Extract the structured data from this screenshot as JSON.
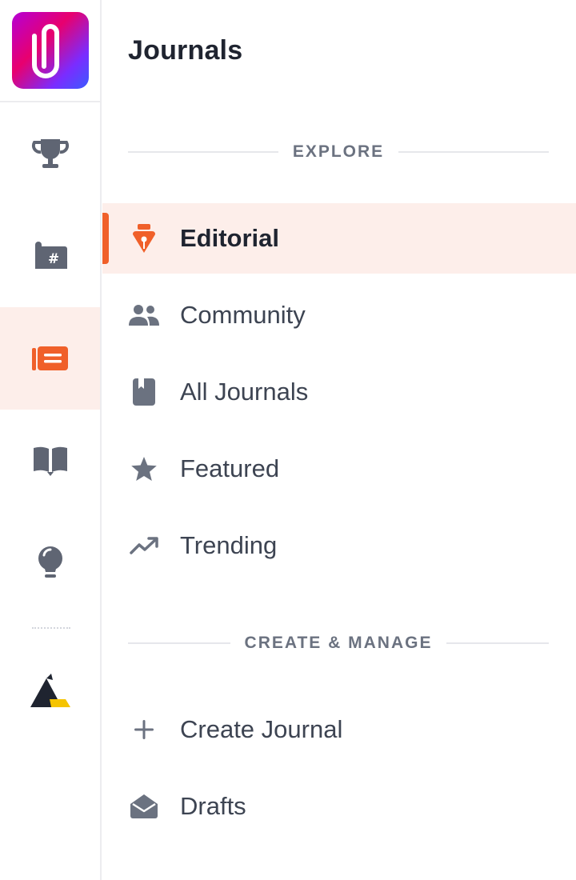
{
  "app": {
    "title": "Journals"
  },
  "rail": {
    "items": [
      {
        "name": "trophy-icon",
        "active": false
      },
      {
        "name": "hashtag-board-icon",
        "active": false
      },
      {
        "name": "newspaper-icon",
        "active": true
      },
      {
        "name": "open-book-icon",
        "active": false
      },
      {
        "name": "lightbulb-icon",
        "active": false
      },
      {
        "name": "brand-triangle-icon",
        "active": false
      }
    ]
  },
  "explore": {
    "heading": "EXPLORE",
    "items": [
      {
        "label": "Editorial",
        "icon": "pen-nib-icon",
        "active": true
      },
      {
        "label": "Community",
        "icon": "people-icon",
        "active": false
      },
      {
        "label": "All Journals",
        "icon": "book-icon",
        "active": false
      },
      {
        "label": "Featured",
        "icon": "star-icon",
        "active": false
      },
      {
        "label": "Trending",
        "icon": "trending-icon",
        "active": false
      }
    ]
  },
  "manage": {
    "heading": "CREATE & MANAGE",
    "items": [
      {
        "label": "Create Journal",
        "icon": "plus-icon"
      },
      {
        "label": "Drafts",
        "icon": "envelope-open-icon"
      }
    ]
  },
  "colors": {
    "accent": "#f0602a",
    "active_bg": "#fdeeea",
    "icon_gray": "#6b7280",
    "text": "#3d4452"
  }
}
